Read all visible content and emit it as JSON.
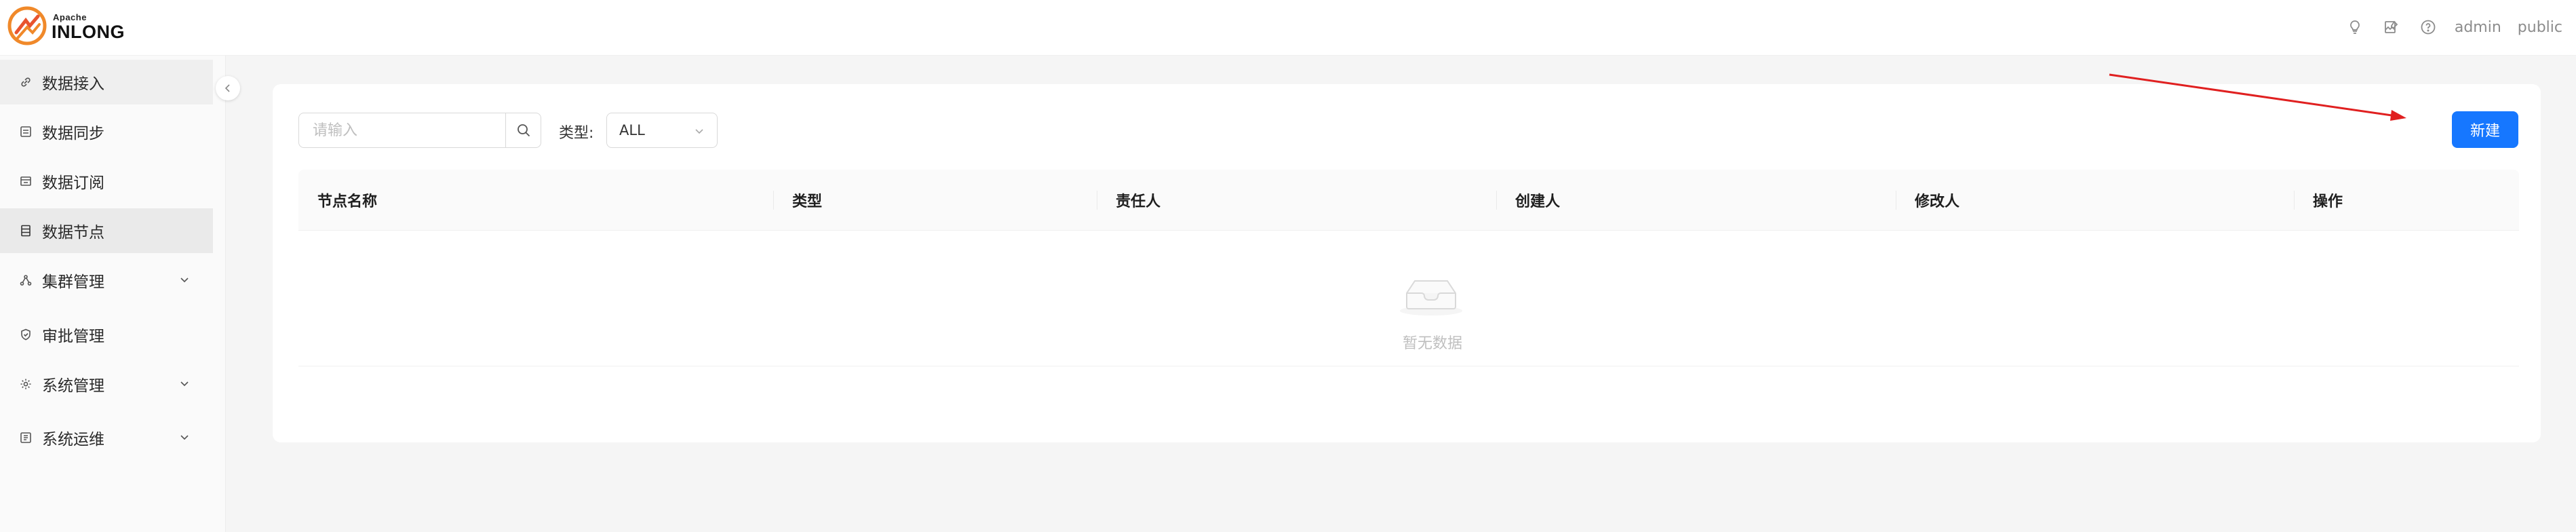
{
  "header": {
    "logo_small": "Apache",
    "logo_big": "INLONG",
    "icons": [
      "lightbulb-icon",
      "image-edit-icon",
      "help-icon"
    ],
    "user": "admin",
    "tenant": "public"
  },
  "sidebar": {
    "items": [
      {
        "label": "数据接入",
        "icon": "link-icon",
        "expandable": false
      },
      {
        "label": "数据同步",
        "icon": "sync-icon",
        "expandable": false
      },
      {
        "label": "数据订阅",
        "icon": "subscribe-icon",
        "expandable": false
      },
      {
        "label": "数据节点",
        "icon": "database-icon",
        "expandable": false,
        "active": true
      },
      {
        "label": "集群管理",
        "icon": "cluster-icon",
        "expandable": true
      },
      {
        "label": "审批管理",
        "icon": "shield-icon",
        "expandable": false
      },
      {
        "label": "系统管理",
        "icon": "gear-icon",
        "expandable": true
      },
      {
        "label": "系统运维",
        "icon": "ops-icon",
        "expandable": true
      }
    ]
  },
  "toolbar": {
    "search_placeholder": "请输入",
    "type_label": "类型:",
    "type_value": "ALL",
    "new_button": "新建"
  },
  "table": {
    "columns": [
      "节点名称",
      "类型",
      "责任人",
      "创建人",
      "修改人",
      "操作"
    ],
    "rows": [],
    "empty_text": "暂无数据"
  },
  "colors": {
    "primary": "#1677ff",
    "annotation_arrow": "#e02020"
  }
}
